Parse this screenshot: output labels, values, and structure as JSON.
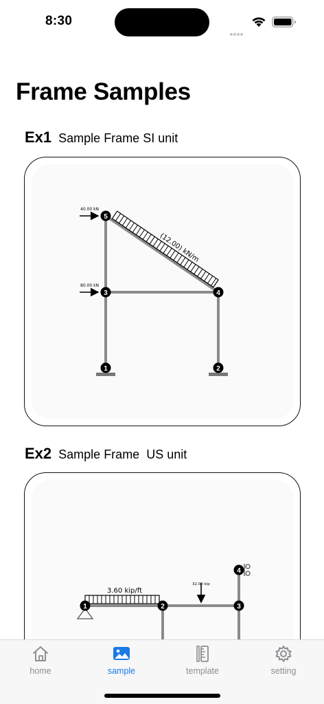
{
  "status": {
    "time": "8:30"
  },
  "page": {
    "title": "Frame Samples"
  },
  "samples": [
    {
      "code": "Ex1",
      "description": "Sample Frame SI unit",
      "diagram": {
        "loads": [
          "40.00 kN",
          "80.00 kN"
        ],
        "distributed_load": "(12.00) kN/m",
        "nodes": [
          "1",
          "2",
          "3",
          "4",
          "5"
        ]
      }
    },
    {
      "code": "Ex2",
      "description": "Sample Frame  US unit",
      "diagram": {
        "distributed_load": "3.60 kip/ft",
        "point_load": "32.00 kip",
        "nodes": [
          "1",
          "2",
          "3",
          "4"
        ]
      }
    }
  ],
  "tabs": [
    {
      "label": "home",
      "icon": "house-icon",
      "active": false
    },
    {
      "label": "sample",
      "icon": "photo-icon",
      "active": true
    },
    {
      "label": "template",
      "icon": "ruler-icon",
      "active": false
    },
    {
      "label": "setting",
      "icon": "gear-icon",
      "active": false
    }
  ],
  "colors": {
    "accent": "#1a7ae6",
    "member": "#8a8a8a",
    "inactive": "#8e8e93"
  }
}
